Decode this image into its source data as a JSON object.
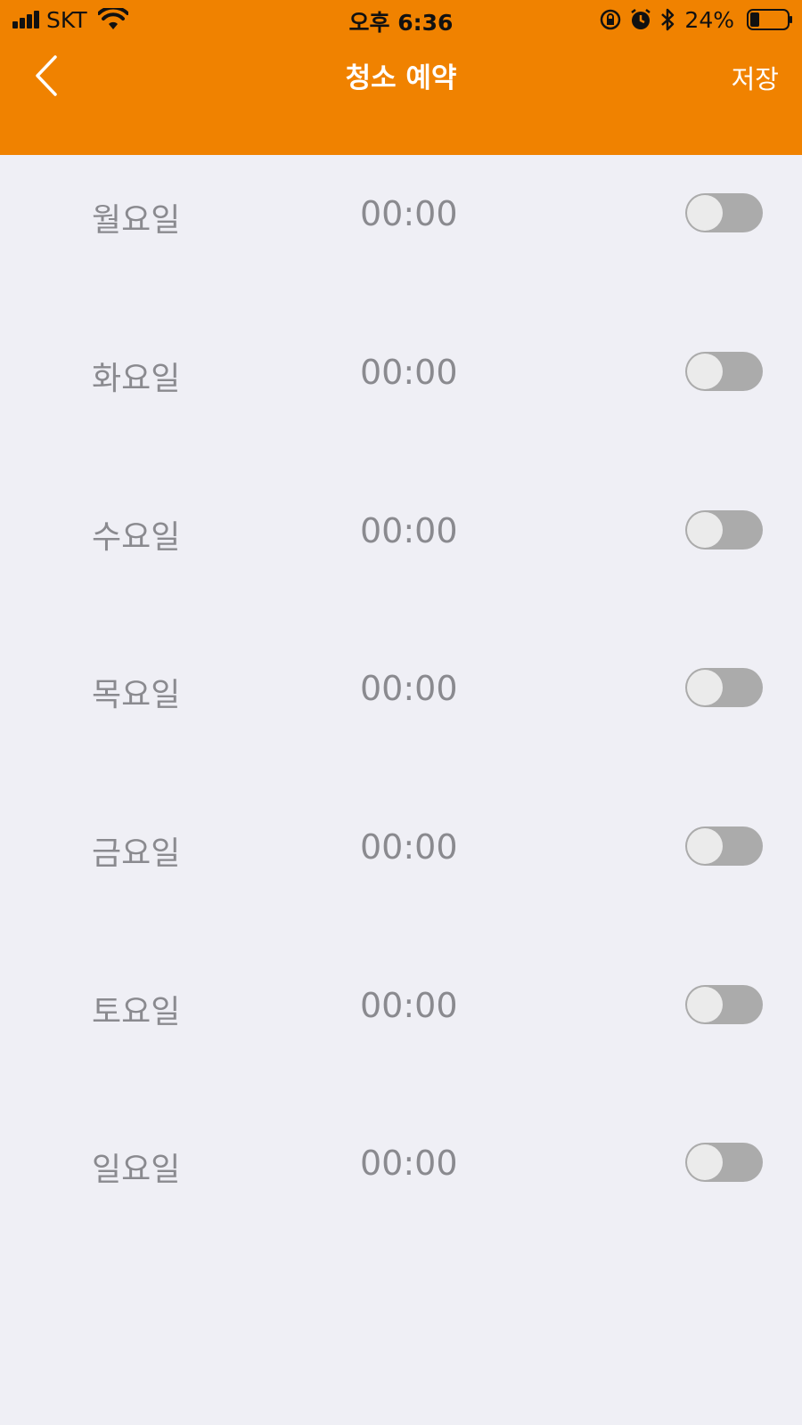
{
  "status_bar": {
    "carrier": "SKT",
    "time": "오후 6:36",
    "battery": "24%"
  },
  "nav": {
    "title": "청소 예약",
    "save_label": "저장"
  },
  "schedule": [
    {
      "day": "월요일",
      "time": "00:00",
      "enabled": false
    },
    {
      "day": "화요일",
      "time": "00:00",
      "enabled": false
    },
    {
      "day": "수요일",
      "time": "00:00",
      "enabled": false
    },
    {
      "day": "목요일",
      "time": "00:00",
      "enabled": false
    },
    {
      "day": "금요일",
      "time": "00:00",
      "enabled": false
    },
    {
      "day": "토요일",
      "time": "00:00",
      "enabled": false
    },
    {
      "day": "일요일",
      "time": "00:00",
      "enabled": false
    }
  ],
  "colors": {
    "header": "#f08200",
    "background": "#efeff5",
    "text_muted": "#8a8a8f",
    "toggle_off": "#ababab"
  }
}
